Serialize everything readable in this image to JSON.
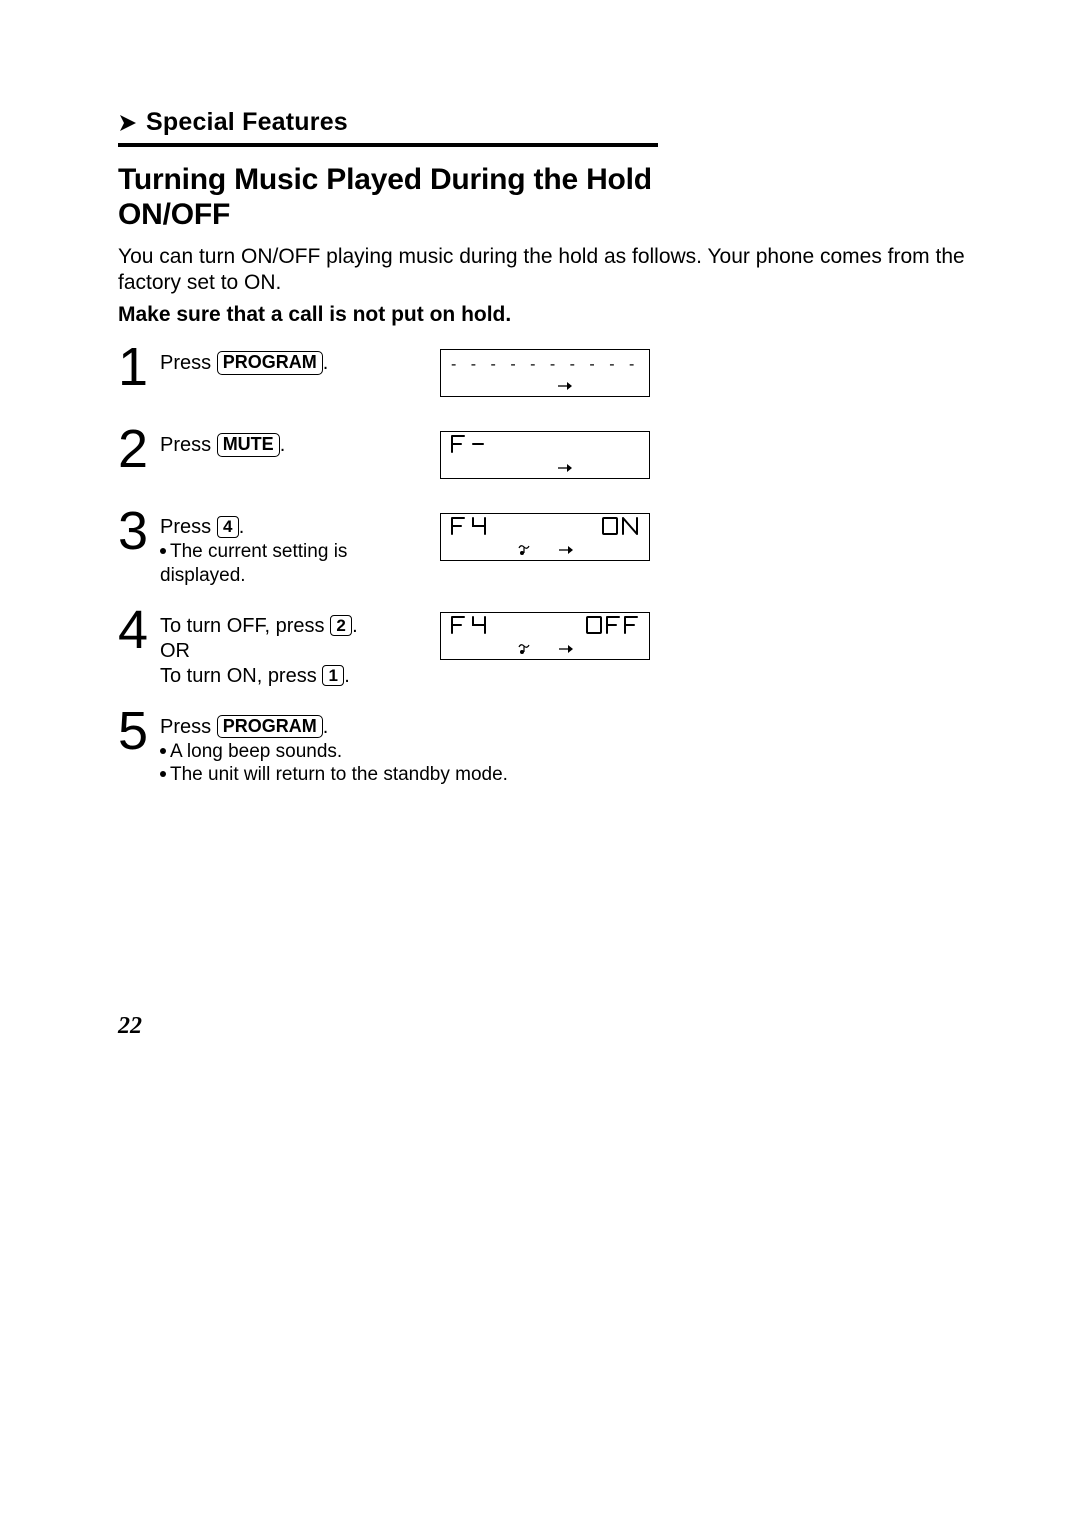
{
  "section_label": "Special Features",
  "title_line1": "Turning Music Played During the Hold",
  "title_line2": "ON/OFF",
  "intro": "You can turn ON/OFF playing music during the hold as follows. Your phone comes from the factory set to ON.",
  "bold_note": "Make sure that a call is not put on hold.",
  "keys": {
    "program": "PROGRAM",
    "mute": "MUTE",
    "k4": "4",
    "k2": "2",
    "k1": "1"
  },
  "steps": {
    "s1": {
      "num": "1",
      "press": "Press ",
      "period": "."
    },
    "s2": {
      "num": "2",
      "press": "Press ",
      "period": "."
    },
    "s3": {
      "num": "3",
      "press": "Press ",
      "period": ".",
      "note": "The current setting is displayed."
    },
    "s4": {
      "num": "4",
      "line1a": "To turn OFF, press ",
      "line1b": ".",
      "or": "OR",
      "line2a": "To turn ON, press ",
      "line2b": "."
    },
    "s5": {
      "num": "5",
      "press": "Press ",
      "period": ".",
      "note1": "A long beep sounds.",
      "note2": "The unit will return to the standby mode."
    }
  },
  "lcd": {
    "dashes": "- - - - - - - - - - - - - - -",
    "s2_left": "F -",
    "s3_left": "F 4",
    "s3_right": "ON",
    "s4_left": "F 4",
    "s4_right": "OFF"
  },
  "page_number": "22"
}
